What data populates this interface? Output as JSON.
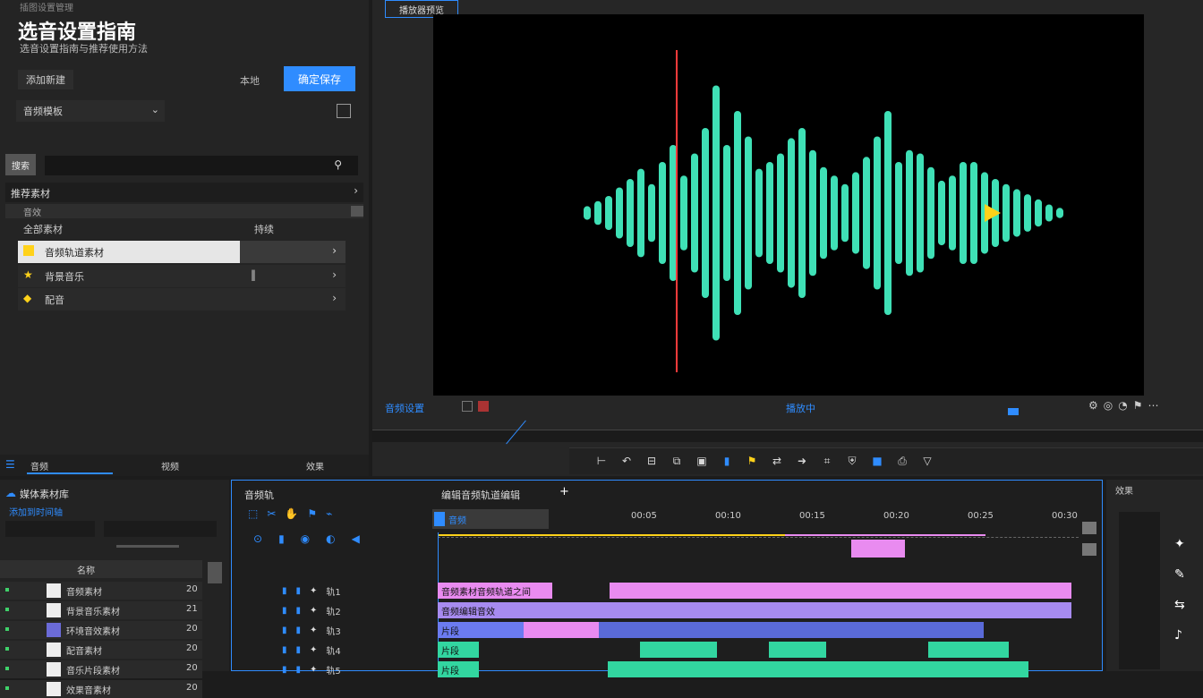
{
  "left_panel": {
    "top_label": "插图设置管理",
    "title": "选音设置指南",
    "subtitle": "选音设置指南与推荐使用方法",
    "row_label": "添加新建",
    "link_label": "本地",
    "primary_button": "确定保存",
    "dropdown_value": "音频模板",
    "search_tab": "搜索",
    "section_header": "推荐素材",
    "subsection_label": "音效",
    "list_header_left": "全部素材",
    "list_header_right": "持续",
    "items": [
      {
        "label": "音频轨道素材"
      },
      {
        "label": "背景音乐"
      },
      {
        "label": "配音"
      }
    ],
    "bottom_tabs": [
      "音频",
      "视频",
      "效果"
    ]
  },
  "preview": {
    "tab_label": "播放器预览",
    "control_left_label": "音频设置",
    "control_center_label": "播放中"
  },
  "bottom_left": {
    "title": "媒体素材库",
    "sub_label": "添加到时间轴",
    "header_label": "名称",
    "rows": [
      {
        "label": "音频素材",
        "val": "20"
      },
      {
        "label": "背景音乐素材",
        "val": "21"
      },
      {
        "label": "环境音效素材",
        "val": "20"
      },
      {
        "label": "配音素材",
        "val": "20"
      },
      {
        "label": "音乐片段素材",
        "val": "20"
      },
      {
        "label": "效果音素材",
        "val": "20"
      }
    ]
  },
  "timeline": {
    "title": "音频轨",
    "sequence_label": "编辑音频轨道编辑",
    "selected_clip": "音频",
    "time_marks": [
      "00:05",
      "00:10",
      "00:15",
      "00:20",
      "00:25",
      "00:30"
    ],
    "tracks": [
      {
        "label": "轨1"
      },
      {
        "label": "轨2"
      },
      {
        "label": "轨3"
      },
      {
        "label": "轨4"
      },
      {
        "label": "轨5"
      }
    ],
    "clips": [
      {
        "label": "音频素材音频轨道之间"
      },
      {
        "label": "音频编辑音效"
      },
      {
        "label": "片段"
      },
      {
        "label": "片段"
      },
      {
        "label": "片段"
      }
    ]
  },
  "right_panel": {
    "title": "效果"
  },
  "colors": {
    "accent_blue": "#2f8cff",
    "waveform": "#3fe0b6",
    "clip_pink": "#e98bf0",
    "clip_purple": "#a78bf0",
    "clip_green": "#32d6a0",
    "playhead": "#ff3b3b",
    "arrow_yellow": "#ffd21a"
  }
}
